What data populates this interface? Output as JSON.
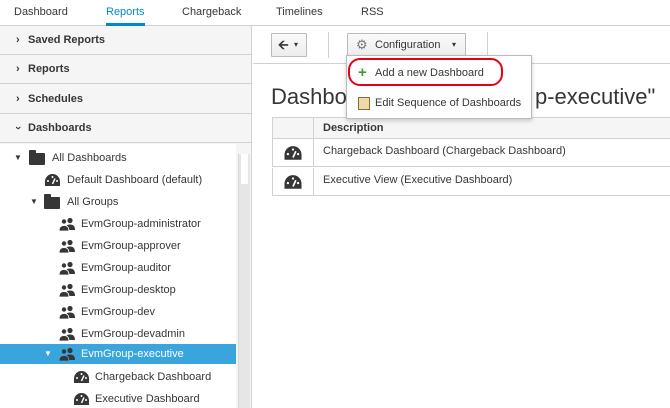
{
  "tabs": [
    "Dashboard",
    "Reports",
    "Chargeback",
    "Timelines",
    "RSS"
  ],
  "active_tab": "Reports",
  "sidebar": {
    "accordions": [
      "Saved Reports",
      "Reports",
      "Schedules",
      "Dashboards"
    ],
    "tree": [
      {
        "label": "All Dashboards",
        "icon": "folder-icon",
        "toggle": "expanded"
      },
      {
        "label": "Default Dashboard (default)",
        "icon": "dashboard-icon",
        "toggle": ""
      },
      {
        "label": "All Groups",
        "icon": "folder-icon",
        "toggle": "expanded"
      },
      {
        "label": "EvmGroup-administrator",
        "icon": "group-icon",
        "toggle": ""
      },
      {
        "label": "EvmGroup-approver",
        "icon": "group-icon",
        "toggle": ""
      },
      {
        "label": "EvmGroup-auditor",
        "icon": "group-icon",
        "toggle": ""
      },
      {
        "label": "EvmGroup-desktop",
        "icon": "group-icon",
        "toggle": ""
      },
      {
        "label": "EvmGroup-dev",
        "icon": "group-icon",
        "toggle": ""
      },
      {
        "label": "EvmGroup-devadmin",
        "icon": "group-icon",
        "toggle": ""
      },
      {
        "label": "EvmGroup-executive",
        "icon": "group-icon",
        "toggle": "expanded",
        "selected": true
      },
      {
        "label": "Chargeback Dashboard",
        "icon": "dashboard-icon",
        "toggle": ""
      },
      {
        "label": "Executive Dashboard",
        "icon": "dashboard-icon",
        "toggle": ""
      }
    ]
  },
  "toolbar": {
    "back_icon": "arrow-left-icon",
    "configuration_label": "Configuration",
    "configuration_icon": "gear-icon"
  },
  "menu": {
    "items": [
      {
        "label": "Add a new Dashboard",
        "icon": "plus-icon",
        "color": "#3f9c35"
      },
      {
        "label": "Edit Sequence of Dashboards",
        "icon": "clipboard-icon"
      }
    ]
  },
  "main": {
    "title_left": "Dashbo",
    "title_right": "p-executive\"",
    "table": {
      "header": "Description",
      "rows": [
        {
          "icon": "dashboard-icon",
          "description": "Chargeback Dashboard (Chargeback Dashboard)"
        },
        {
          "icon": "dashboard-icon",
          "description": "Executive View (Executive Dashboard)"
        }
      ]
    }
  },
  "colors": {
    "accent": "#0088ce",
    "selected_row": "#39a5dc",
    "highlight_ring": "#e5001a"
  }
}
